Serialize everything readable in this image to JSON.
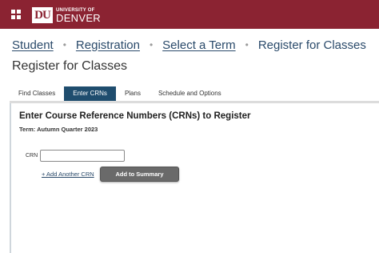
{
  "header": {
    "logo_mark": "DU",
    "logo_small": "UNIVERSITY OF",
    "logo_large": "DENVER"
  },
  "breadcrumb": {
    "items": [
      "Student",
      "Registration",
      "Select a Term",
      "Register for Classes"
    ],
    "separator": "•"
  },
  "page": {
    "title": "Register for Classes"
  },
  "tabs": [
    {
      "label": "Find Classes",
      "active": false
    },
    {
      "label": "Enter CRNs",
      "active": true
    },
    {
      "label": "Plans",
      "active": false
    },
    {
      "label": "Schedule and Options",
      "active": false
    }
  ],
  "panel": {
    "heading": "Enter Course Reference Numbers (CRNs) to Register",
    "term": "Term: Autumn Quarter 2023",
    "crn_label": "CRN",
    "crn_value": "",
    "add_link": "+ Add Another CRN",
    "submit_label": "Add to Summary"
  },
  "colors": {
    "brand": "#8b2332",
    "active_tab": "#1f4d6e",
    "link": "#2a4a6a"
  }
}
